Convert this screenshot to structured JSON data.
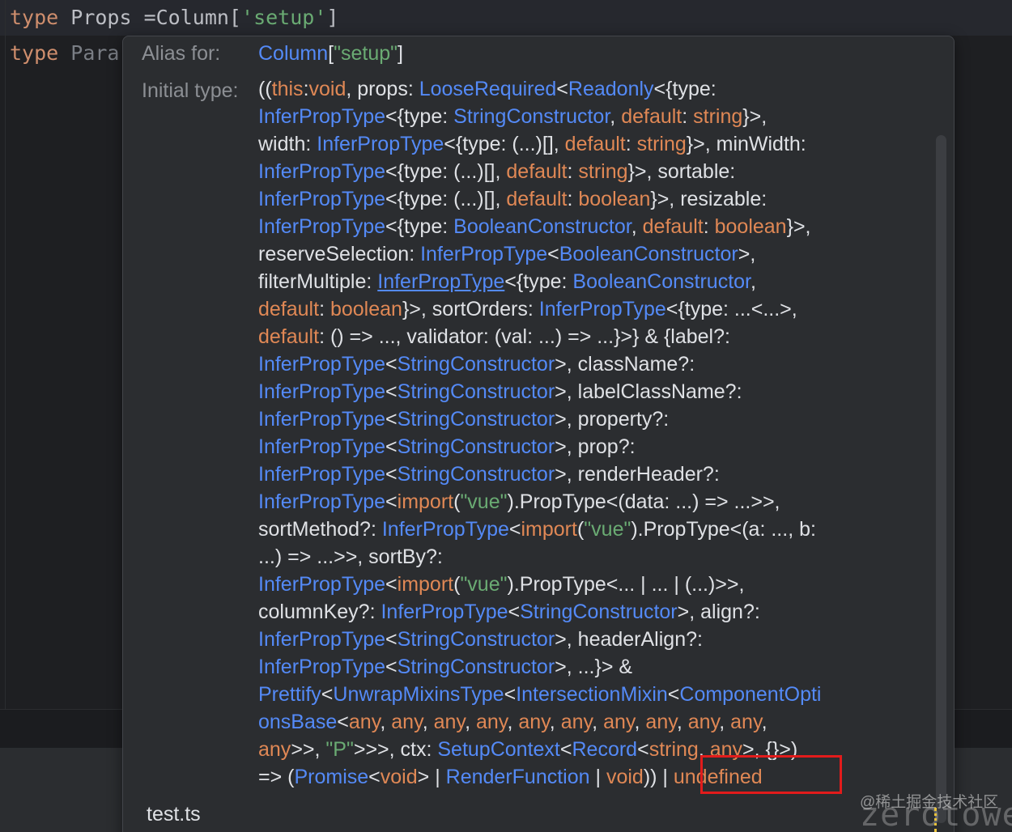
{
  "editor": {
    "line1": {
      "kw": "type",
      "name": " Props ",
      "op": "=Column[",
      "quote_open": "'",
      "str": "setup",
      "quote_close": "'",
      "close": "]"
    },
    "line2": {
      "kw": "type",
      "name": " Para"
    }
  },
  "popup": {
    "alias_label": "Alias for:",
    "alias_type": "Column",
    "alias_open": "[",
    "alias_str": "\"setup\"",
    "alias_close": "]",
    "initial_label": "Initial type:",
    "file": "test.ts",
    "lines": [
      [
        [
          "p",
          "(("
        ],
        [
          "k",
          "this"
        ],
        [
          "p",
          ":"
        ],
        [
          "k",
          "void"
        ],
        [
          "p",
          ", props: "
        ],
        [
          "t",
          "LooseRequired"
        ],
        [
          "p",
          "<"
        ],
        [
          "t",
          "Readonly"
        ],
        [
          "p",
          "<{type:"
        ]
      ],
      [
        [
          "t",
          "InferPropType"
        ],
        [
          "p",
          "<{type: "
        ],
        [
          "t",
          "StringConstructor"
        ],
        [
          "p",
          ", "
        ],
        [
          "k",
          "default"
        ],
        [
          "p",
          ": "
        ],
        [
          "k",
          "string"
        ],
        [
          "p",
          "}>,"
        ]
      ],
      [
        [
          "p",
          "width: "
        ],
        [
          "t",
          "InferPropType"
        ],
        [
          "p",
          "<{type: (...)[], "
        ],
        [
          "k",
          "default"
        ],
        [
          "p",
          ": "
        ],
        [
          "k",
          "string"
        ],
        [
          "p",
          "}>, minWidth:"
        ]
      ],
      [
        [
          "t",
          "InferPropType"
        ],
        [
          "p",
          "<{type: (...)[], "
        ],
        [
          "k",
          "default"
        ],
        [
          "p",
          ": "
        ],
        [
          "k",
          "string"
        ],
        [
          "p",
          "}>, sortable:"
        ]
      ],
      [
        [
          "t",
          "InferPropType"
        ],
        [
          "p",
          "<{type: (...)[], "
        ],
        [
          "k",
          "default"
        ],
        [
          "p",
          ": "
        ],
        [
          "k",
          "boolean"
        ],
        [
          "p",
          "}>, resizable:"
        ]
      ],
      [
        [
          "t",
          "InferPropType"
        ],
        [
          "p",
          "<{type: "
        ],
        [
          "t",
          "BooleanConstructor"
        ],
        [
          "p",
          ", "
        ],
        [
          "k",
          "default"
        ],
        [
          "p",
          ": "
        ],
        [
          "k",
          "boolean"
        ],
        [
          "p",
          "}>,"
        ]
      ],
      [
        [
          "p",
          "reserveSelection: "
        ],
        [
          "t",
          "InferPropType"
        ],
        [
          "p",
          "<"
        ],
        [
          "t",
          "BooleanConstructor"
        ],
        [
          "p",
          ">,"
        ]
      ],
      [
        [
          "p",
          "filterMultiple: "
        ],
        [
          "u",
          "InferPropType"
        ],
        [
          "p",
          "<{type: "
        ],
        [
          "t",
          "BooleanConstructor"
        ],
        [
          "p",
          ","
        ]
      ],
      [
        [
          "k",
          "default"
        ],
        [
          "p",
          ": "
        ],
        [
          "k",
          "boolean"
        ],
        [
          "p",
          "}>, sortOrders: "
        ],
        [
          "t",
          "InferPropType"
        ],
        [
          "p",
          "<{type: ...<...>,"
        ]
      ],
      [
        [
          "k",
          "default"
        ],
        [
          "p",
          ": () => ..., validator: (val: ...) => ...}>} & {label?:"
        ]
      ],
      [
        [
          "t",
          "InferPropType"
        ],
        [
          "p",
          "<"
        ],
        [
          "t",
          "StringConstructor"
        ],
        [
          "p",
          ">, className?:"
        ]
      ],
      [
        [
          "t",
          "InferPropType"
        ],
        [
          "p",
          "<"
        ],
        [
          "t",
          "StringConstructor"
        ],
        [
          "p",
          ">, labelClassName?:"
        ]
      ],
      [
        [
          "t",
          "InferPropType"
        ],
        [
          "p",
          "<"
        ],
        [
          "t",
          "StringConstructor"
        ],
        [
          "p",
          ">, property?:"
        ]
      ],
      [
        [
          "t",
          "InferPropType"
        ],
        [
          "p",
          "<"
        ],
        [
          "t",
          "StringConstructor"
        ],
        [
          "p",
          ">, prop?:"
        ]
      ],
      [
        [
          "t",
          "InferPropType"
        ],
        [
          "p",
          "<"
        ],
        [
          "t",
          "StringConstructor"
        ],
        [
          "p",
          ">, renderHeader?:"
        ]
      ],
      [
        [
          "t",
          "InferPropType"
        ],
        [
          "p",
          "<"
        ],
        [
          "k",
          "import"
        ],
        [
          "p",
          "("
        ],
        [
          "s",
          "\"vue\""
        ],
        [
          "p",
          ").PropType<(data: ...) => ...>>,"
        ]
      ],
      [
        [
          "p",
          "sortMethod?: "
        ],
        [
          "t",
          "InferPropType"
        ],
        [
          "p",
          "<"
        ],
        [
          "k",
          "import"
        ],
        [
          "p",
          "("
        ],
        [
          "s",
          "\"vue\""
        ],
        [
          "p",
          ").PropType<(a: ..., b:"
        ]
      ],
      [
        [
          "p",
          "...) => ...>>, sortBy?:"
        ]
      ],
      [
        [
          "t",
          "InferPropType"
        ],
        [
          "p",
          "<"
        ],
        [
          "k",
          "import"
        ],
        [
          "p",
          "("
        ],
        [
          "s",
          "\"vue\""
        ],
        [
          "p",
          ").PropType<... | ... | (...)>>,"
        ]
      ],
      [
        [
          "p",
          "columnKey?: "
        ],
        [
          "t",
          "InferPropType"
        ],
        [
          "p",
          "<"
        ],
        [
          "t",
          "StringConstructor"
        ],
        [
          "p",
          ">, align?:"
        ]
      ],
      [
        [
          "t",
          "InferPropType"
        ],
        [
          "p",
          "<"
        ],
        [
          "t",
          "StringConstructor"
        ],
        [
          "p",
          ">, headerAlign?:"
        ]
      ],
      [
        [
          "t",
          "InferPropType"
        ],
        [
          "p",
          "<"
        ],
        [
          "t",
          "StringConstructor"
        ],
        [
          "p",
          ">, ...}> &"
        ]
      ],
      [
        [
          "t",
          "Prettify"
        ],
        [
          "p",
          "<"
        ],
        [
          "t",
          "UnwrapMixinsType"
        ],
        [
          "p",
          "<"
        ],
        [
          "t",
          "IntersectionMixin"
        ],
        [
          "p",
          "<"
        ],
        [
          "t",
          "ComponentOpti"
        ]
      ],
      [
        [
          "t",
          "onsBase"
        ],
        [
          "p",
          "<"
        ],
        [
          "k",
          "any"
        ],
        [
          "p",
          ", "
        ],
        [
          "k",
          "any"
        ],
        [
          "p",
          ", "
        ],
        [
          "k",
          "any"
        ],
        [
          "p",
          ", "
        ],
        [
          "k",
          "any"
        ],
        [
          "p",
          ", "
        ],
        [
          "k",
          "any"
        ],
        [
          "p",
          ", "
        ],
        [
          "k",
          "any"
        ],
        [
          "p",
          ", "
        ],
        [
          "k",
          "any"
        ],
        [
          "p",
          ", "
        ],
        [
          "k",
          "any"
        ],
        [
          "p",
          ", "
        ],
        [
          "k",
          "any"
        ],
        [
          "p",
          ", "
        ],
        [
          "k",
          "any"
        ],
        [
          "p",
          ","
        ]
      ],
      [
        [
          "k",
          "any"
        ],
        [
          "p",
          ">>, "
        ],
        [
          "s",
          "\"P\""
        ],
        [
          "p",
          ">>>, ctx: "
        ],
        [
          "t",
          "SetupContext"
        ],
        [
          "p",
          "<"
        ],
        [
          "t",
          "Record"
        ],
        [
          "p",
          "<"
        ],
        [
          "k",
          "string"
        ],
        [
          "p",
          ", "
        ],
        [
          "k",
          "any"
        ],
        [
          "p",
          ">, {}>)"
        ]
      ],
      [
        [
          "p",
          "=> ("
        ],
        [
          "t",
          "Promise"
        ],
        [
          "p",
          "<"
        ],
        [
          "k",
          "void"
        ],
        [
          "p",
          "> | "
        ],
        [
          "t",
          "RenderFunction"
        ],
        [
          "p",
          " | "
        ],
        [
          "k",
          "void"
        ],
        [
          "p",
          ")) | "
        ],
        [
          "k",
          "undefined"
        ]
      ]
    ]
  },
  "watermark": {
    "text": "@稀土掘金技术社区",
    "overlay": "zerotower"
  },
  "colors": {
    "type": "#548af7",
    "keyword": "#cf8e6d",
    "string": "#6aab73",
    "highlight_box": "#e21b1b"
  }
}
